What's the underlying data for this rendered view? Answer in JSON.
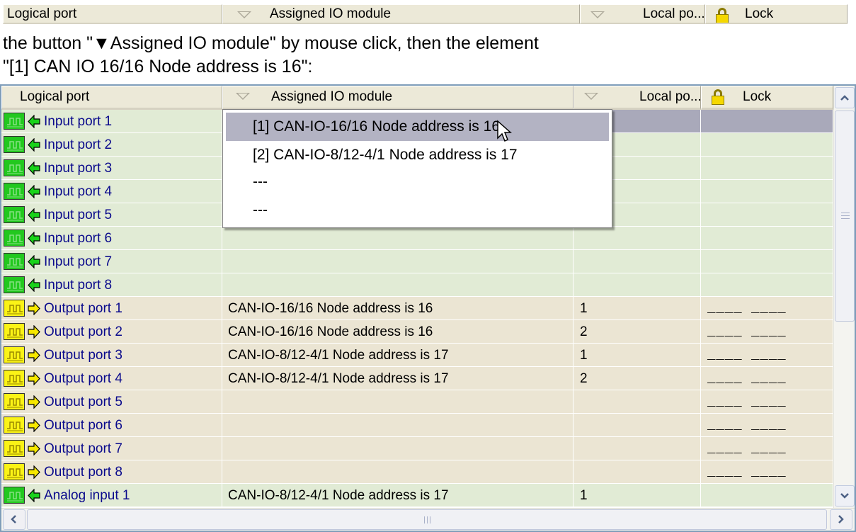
{
  "top_header": {
    "logical_port": "Logical port",
    "assigned_module": "Assigned IO module",
    "local_port": "Local po...",
    "lock": "Lock"
  },
  "caption": {
    "line1": " the button \"▼Assigned IO module\" by mouse click, then the element",
    "line2": "\"[1] CAN IO 16/16 Node address is 16\":"
  },
  "grid_header": {
    "logical_port": "Logical port",
    "assigned_module": "Assigned IO module",
    "local_port": "Local po...",
    "lock": "Lock"
  },
  "rows": [
    {
      "name": "Input port 1",
      "module": "",
      "local": "",
      "lock": ""
    },
    {
      "name": "Input port 2",
      "module": "",
      "local": "",
      "lock": ""
    },
    {
      "name": "Input port 3",
      "module": "",
      "local": "",
      "lock": ""
    },
    {
      "name": "Input port 4",
      "module": "",
      "local": "",
      "lock": ""
    },
    {
      "name": "Input port 5",
      "module": "",
      "local": "",
      "lock": ""
    },
    {
      "name": "Input port 6",
      "module": "",
      "local": "",
      "lock": ""
    },
    {
      "name": "Input port 7",
      "module": "",
      "local": "",
      "lock": ""
    },
    {
      "name": "Input port 8",
      "module": "",
      "local": "",
      "lock": ""
    },
    {
      "name": "Output port 1",
      "module": "CAN-IO-16/16 Node address is 16",
      "local": "1",
      "lock": "____ ____"
    },
    {
      "name": "Output port 2",
      "module": "CAN-IO-16/16 Node address is 16",
      "local": "2",
      "lock": "____ ____"
    },
    {
      "name": "Output port 3",
      "module": "CAN-IO-8/12-4/1 Node address is 17",
      "local": "1",
      "lock": "____ ____"
    },
    {
      "name": "Output port 4",
      "module": "CAN-IO-8/12-4/1 Node address is 17",
      "local": "2",
      "lock": "____ ____"
    },
    {
      "name": "Output port 5",
      "module": "",
      "local": "",
      "lock": "____ ____"
    },
    {
      "name": "Output port 6",
      "module": "",
      "local": "",
      "lock": "____ ____"
    },
    {
      "name": "Output port 7",
      "module": "",
      "local": "",
      "lock": "____ ____"
    },
    {
      "name": "Output port 8",
      "module": "",
      "local": "",
      "lock": "____ ____"
    },
    {
      "name": "Analog input 1",
      "module": "CAN-IO-8/12-4/1 Node address is 17",
      "local": "1",
      "lock": ""
    }
  ],
  "dropdown": {
    "items": [
      "[1] CAN-IO-16/16 Node address is 16",
      "[2] CAN-IO-8/12-4/1 Node address is 17",
      "---",
      "---"
    ]
  }
}
